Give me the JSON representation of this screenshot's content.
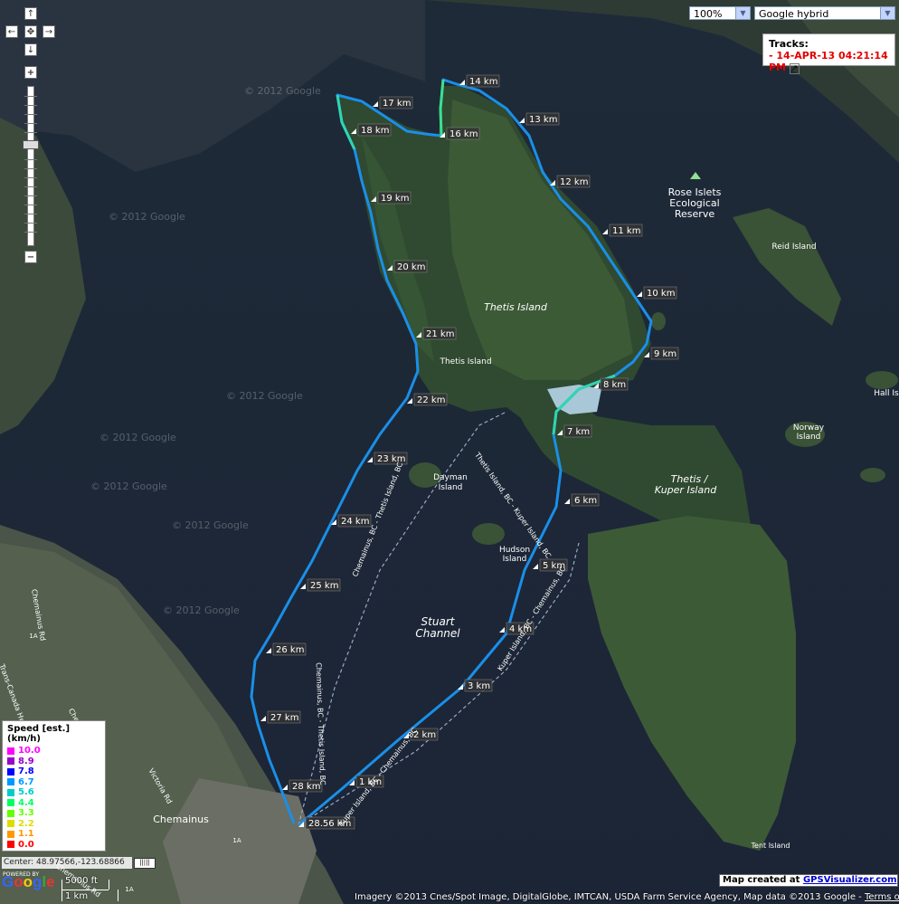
{
  "map": {
    "zoom_level": "100%",
    "map_type": "Google hybrid",
    "tracks_title": "Tracks:",
    "track_entry": "- 14-APR-13 04:21:14 PM",
    "center_text": "Center: 48.97566,-123.68866",
    "credit_prefix": "Map created at ",
    "credit_link": "GPSVisualizer.com",
    "imagery_text": "Imagery ©2013 Cnes/Spot Image, DigitalGlobe, IMTCAN, USDA Farm Service Agency, Map data ©2013 Google -",
    "terms_link": "Terms of Use",
    "scale_ft": "5000 ft",
    "scale_km": "1 km",
    "google_logo": "Google",
    "powered_by": "POWERED BY",
    "watermarks": [
      "© 2012 Google",
      "© 2012 Google",
      "© 2012 Google",
      "© 2012 Google",
      "© 2012 Google",
      "© 2012 Google",
      "© 2012 Google"
    ],
    "nav_icons": [
      "arrow-up-icon",
      "arrow-left-icon",
      "pan-center-icon",
      "arrow-right-icon",
      "arrow-down-icon",
      "zoom-in-icon",
      "zoom-out-icon"
    ],
    "zoom_in": "+",
    "zoom_out": "−"
  },
  "legend": {
    "title": "Speed [est.] (km/h)",
    "items": [
      {
        "value": "10.0",
        "color": "#ff00ff"
      },
      {
        "value": "8.9",
        "color": "#9900cc"
      },
      {
        "value": "7.8",
        "color": "#0000ff"
      },
      {
        "value": "6.7",
        "color": "#0099ff"
      },
      {
        "value": "5.6",
        "color": "#00cccc"
      },
      {
        "value": "4.4",
        "color": "#00ff66"
      },
      {
        "value": "3.3",
        "color": "#66ff00"
      },
      {
        "value": "2.2",
        "color": "#dddd00"
      },
      {
        "value": "1.1",
        "color": "#ff9900"
      },
      {
        "value": "0.0",
        "color": "#ff0000"
      }
    ]
  },
  "places": [
    "Thetis Island",
    "Thetis Island",
    "Rose Islets",
    "Ecological",
    "Reserve",
    "Reid Island",
    "Hall Is",
    "Norway",
    "Island",
    "Thetis /",
    "Kuper Island",
    "Dayman",
    "Island",
    "Hudson",
    "Island",
    "Stuart",
    "Channel",
    "Chemainus",
    "Tent Island"
  ],
  "roads": [
    "Chemainus, BC - Thetis Island, BC",
    "Chemainus, BC - Thetis Island, BC",
    "Thetis Island, BC - Kuper Island, BC",
    "Kuper Island, BC - Chemainus, BC",
    "Kuper Island, BC - Chemainus, BC",
    "Chemainus Rd",
    "Chemainus Rd",
    "Victoria Rd",
    "Trans-Canada Hwy",
    "Chemainus Rd",
    "1A",
    "1A",
    "1A"
  ],
  "km_markers": [
    "1 km",
    "2 km",
    "3 km",
    "4 km",
    "5 km",
    "6 km",
    "7 km",
    "8 km",
    "9 km",
    "10 km",
    "11 km",
    "12 km",
    "13 km",
    "14 km",
    "16 km",
    "17 km",
    "18 km",
    "19 km",
    "20 km",
    "21 km",
    "22 km",
    "23 km",
    "24 km",
    "25 km",
    "26 km",
    "27 km",
    "28 km",
    "28.56 km"
  ]
}
